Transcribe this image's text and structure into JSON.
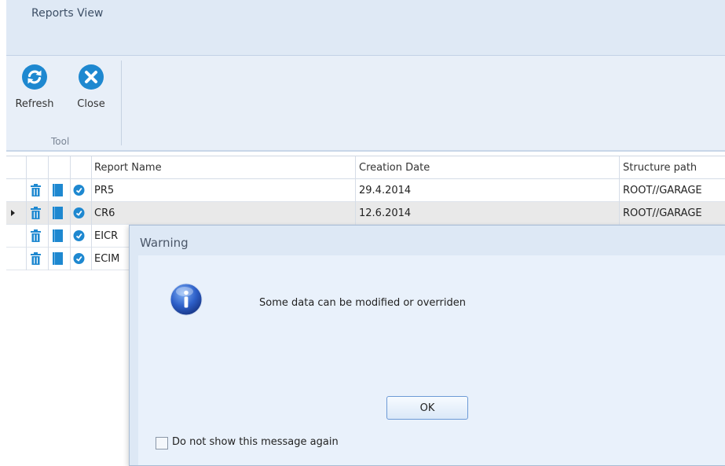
{
  "window": {
    "title": "Reports View"
  },
  "ribbon": {
    "buttons": [
      {
        "label": "Refresh",
        "icon": "refresh-icon"
      },
      {
        "label": "Close",
        "icon": "close-icon"
      }
    ],
    "group_label": "Tool",
    "accent": "#1e88d0"
  },
  "grid": {
    "columns": [
      "Report Name",
      "Creation Date",
      "Structure path"
    ],
    "rows": [
      {
        "name": "PR5",
        "date": "29.4.2014",
        "path": "ROOT//GARAGE",
        "selected": false
      },
      {
        "name": "CR6",
        "date": "12.6.2014",
        "path": "ROOT//GARAGE",
        "selected": true
      },
      {
        "name": "EICR",
        "date": "",
        "path": "",
        "selected": false
      },
      {
        "name": "ECIM",
        "date": "",
        "path": "",
        "selected": false
      }
    ],
    "row_icons": [
      "trash-icon",
      "book-icon",
      "clock-icon"
    ]
  },
  "dialog": {
    "title": "Warning",
    "icon": "info-icon",
    "message": "Some data can be modified or overriden",
    "ok_label": "OK",
    "checkbox_label": "Do not show this message again",
    "checkbox_checked": false
  }
}
